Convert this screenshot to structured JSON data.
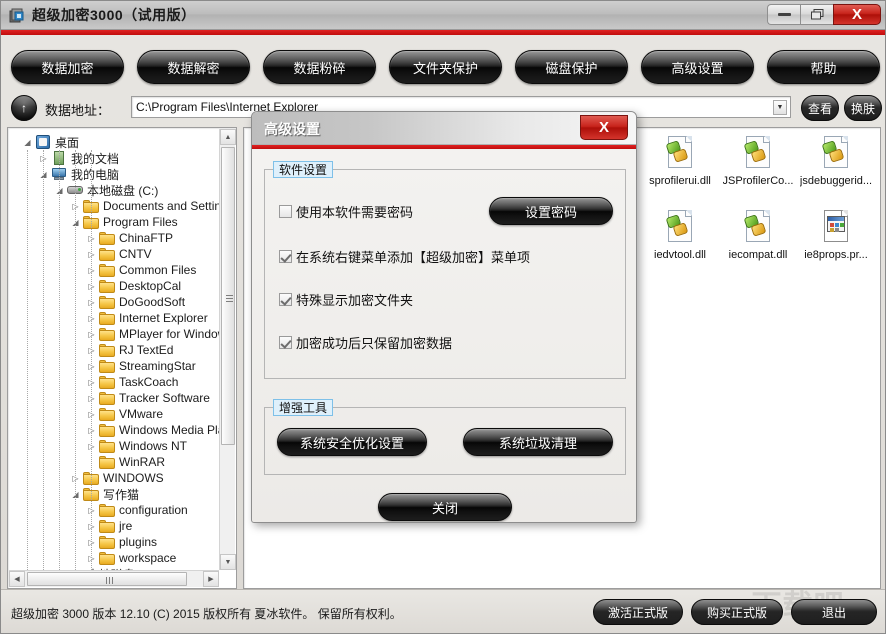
{
  "window": {
    "title": "超级加密3000（试用版）",
    "icon": "app-icon",
    "minimize_label": "",
    "maximize_label": "❐",
    "close_label": "X"
  },
  "toolbar": {
    "buttons": [
      {
        "label": "数据加密"
      },
      {
        "label": "数据解密"
      },
      {
        "label": "数据粉碎"
      },
      {
        "label": "文件夹保护"
      },
      {
        "label": "磁盘保护"
      },
      {
        "label": "高级设置"
      },
      {
        "label": "帮助"
      }
    ]
  },
  "address_bar": {
    "up_icon": "up-arrow-icon",
    "label": "数据地址：",
    "value": "C:\\Program Files\\Internet Explorer",
    "dropdown_icon": "chevron-down-icon",
    "view_button": "查看",
    "skin_button": "换肤"
  },
  "tree": {
    "nodes": [
      {
        "label": "桌面",
        "depth": 0,
        "expander": "expanded",
        "icon": "desktop-icon"
      },
      {
        "label": "我的文档",
        "depth": 1,
        "expander": "collapsed",
        "icon": "documents-icon"
      },
      {
        "label": "我的电脑",
        "depth": 1,
        "expander": "expanded",
        "icon": "computer-icon"
      },
      {
        "label": "本地磁盘 (C:)",
        "depth": 2,
        "expander": "expanded",
        "icon": "disk-icon"
      },
      {
        "label": "Documents and Settings",
        "depth": 3,
        "expander": "collapsed",
        "icon": "folder-icon"
      },
      {
        "label": "Program Files",
        "depth": 3,
        "expander": "expanded",
        "icon": "folder-icon"
      },
      {
        "label": "ChinaFTP",
        "depth": 4,
        "expander": "collapsed",
        "icon": "folder-icon"
      },
      {
        "label": "CNTV",
        "depth": 4,
        "expander": "collapsed",
        "icon": "folder-icon"
      },
      {
        "label": "Common Files",
        "depth": 4,
        "expander": "collapsed",
        "icon": "folder-icon"
      },
      {
        "label": "DesktopCal",
        "depth": 4,
        "expander": "collapsed",
        "icon": "folder-icon"
      },
      {
        "label": "DoGoodSoft",
        "depth": 4,
        "expander": "collapsed",
        "icon": "folder-icon"
      },
      {
        "label": "Internet Explorer",
        "depth": 4,
        "expander": "collapsed",
        "icon": "folder-icon"
      },
      {
        "label": "MPlayer for Window",
        "depth": 4,
        "expander": "collapsed",
        "icon": "folder-icon"
      },
      {
        "label": "RJ TextEd",
        "depth": 4,
        "expander": "collapsed",
        "icon": "folder-icon"
      },
      {
        "label": "StreamingStar",
        "depth": 4,
        "expander": "collapsed",
        "icon": "folder-icon"
      },
      {
        "label": "TaskCoach",
        "depth": 4,
        "expander": "collapsed",
        "icon": "folder-icon"
      },
      {
        "label": "Tracker Software",
        "depth": 4,
        "expander": "collapsed",
        "icon": "folder-icon"
      },
      {
        "label": "VMware",
        "depth": 4,
        "expander": "collapsed",
        "icon": "folder-icon"
      },
      {
        "label": "Windows Media Pla",
        "depth": 4,
        "expander": "collapsed",
        "icon": "folder-icon"
      },
      {
        "label": "Windows NT",
        "depth": 4,
        "expander": "collapsed",
        "icon": "folder-icon"
      },
      {
        "label": "WinRAR",
        "depth": 4,
        "expander": "none",
        "icon": "folder-icon"
      },
      {
        "label": "WINDOWS",
        "depth": 3,
        "expander": "collapsed",
        "icon": "folder-icon"
      },
      {
        "label": "写作猫",
        "depth": 3,
        "expander": "expanded",
        "icon": "folder-icon"
      },
      {
        "label": "configuration",
        "depth": 4,
        "expander": "collapsed",
        "icon": "folder-icon"
      },
      {
        "label": "jre",
        "depth": 4,
        "expander": "collapsed",
        "icon": "folder-icon"
      },
      {
        "label": "plugins",
        "depth": 4,
        "expander": "collapsed",
        "icon": "folder-icon"
      },
      {
        "label": "workspace",
        "depth": 4,
        "expander": "collapsed",
        "icon": "folder-icon"
      },
      {
        "label": "本地磁盘 (D:)",
        "depth": 2,
        "expander": "collapsed",
        "icon": "disk-icon"
      }
    ]
  },
  "files": {
    "items": [
      {
        "name": "sprofilerui.dll",
        "icon": "dll-icon"
      },
      {
        "name": "JSProfilerCo...",
        "icon": "dll-icon"
      },
      {
        "name": "jsdebuggerid...",
        "icon": "dll-icon"
      },
      {
        "name": "iedvtool.dll",
        "icon": "dll-icon"
      },
      {
        "name": "iecompat.dll",
        "icon": "dll-icon"
      },
      {
        "name": "ie8props.pr...",
        "icon": "properties-icon"
      }
    ]
  },
  "dialog": {
    "title": "高级设置",
    "close_label": "X",
    "software_group": {
      "label": "软件设置",
      "checkboxes": [
        {
          "label": "使用本软件需要密码",
          "checked": false
        },
        {
          "label": "在系统右键菜单添加【超级加密】菜单项",
          "checked": true
        },
        {
          "label": "特殊显示加密文件夹",
          "checked": true
        },
        {
          "label": "加密成功后只保留加密数据",
          "checked": true
        }
      ],
      "set_password_button": "设置密码"
    },
    "tools_group": {
      "label": "增强工具",
      "buttons": [
        {
          "label": "系统安全优化设置"
        },
        {
          "label": "系统垃圾清理"
        }
      ]
    },
    "close_button": "关闭"
  },
  "status": {
    "text": "超级加密 3000  版本 12.10  (C)  2015 版权所有 夏冰软件。 保留所有权利。",
    "buttons": [
      {
        "label": "激活正式版"
      },
      {
        "label": "购买正式版"
      },
      {
        "label": "退出"
      }
    ],
    "watermark": "下载吧"
  },
  "colors": {
    "accent_red": "#c00d0d",
    "title_gray": "#bdbdbd",
    "group_label_bg": "#dff0fb"
  }
}
